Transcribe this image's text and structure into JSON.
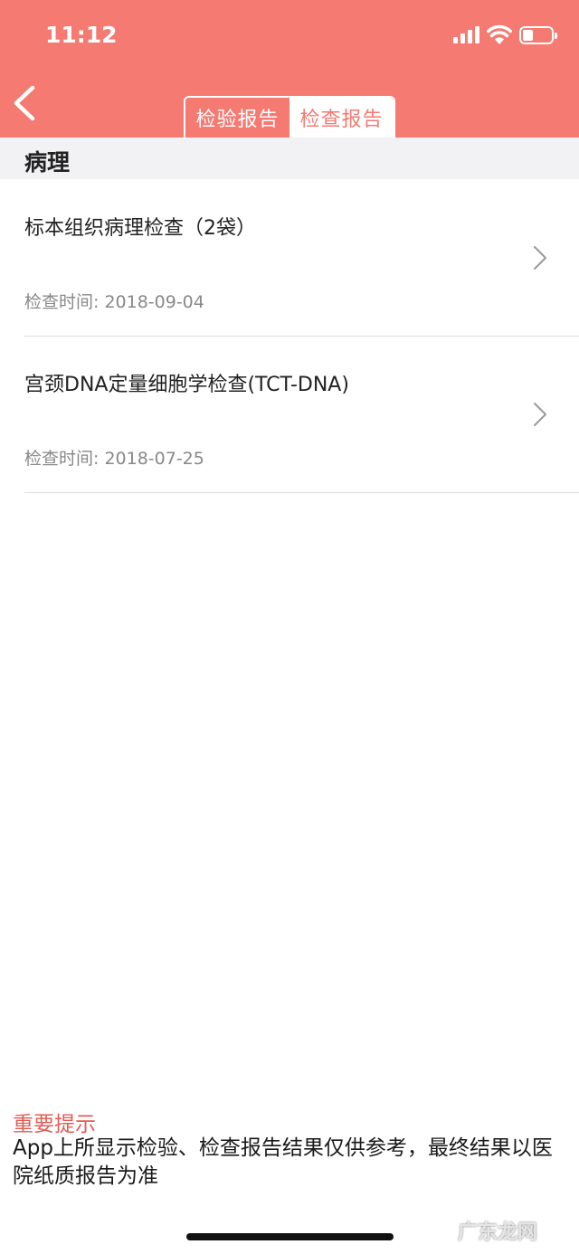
{
  "status_bar": {
    "time": "11:12",
    "signal_icon": "cellular-signal-icon",
    "wifi_icon": "wifi-icon",
    "battery_icon": "battery-icon",
    "battery_level": 0.35
  },
  "header": {
    "back_icon": "chevron-left-icon",
    "tabs": [
      {
        "label": "检验报告",
        "active": false
      },
      {
        "label": "检查报告",
        "active": true
      }
    ],
    "color": "#f47a72"
  },
  "section": {
    "title": "病理"
  },
  "reports": [
    {
      "title": "标本组织病理检查（2袋）",
      "time": "检查时间: 2018-09-04"
    },
    {
      "title": "宫颈DNA定量细胞学检查(TCT-DNA)",
      "time": "检查时间: 2018-07-25"
    }
  ],
  "notice": {
    "title": "重要提示",
    "text": "App上所显示检验、检查报告结果仅供参考，最终结果以医院纸质报告为准"
  },
  "watermark": "广东龙网",
  "colors": {
    "accent": "#f47a72",
    "notice_title": "#e15d55",
    "section_bg": "#f2f2f4"
  }
}
